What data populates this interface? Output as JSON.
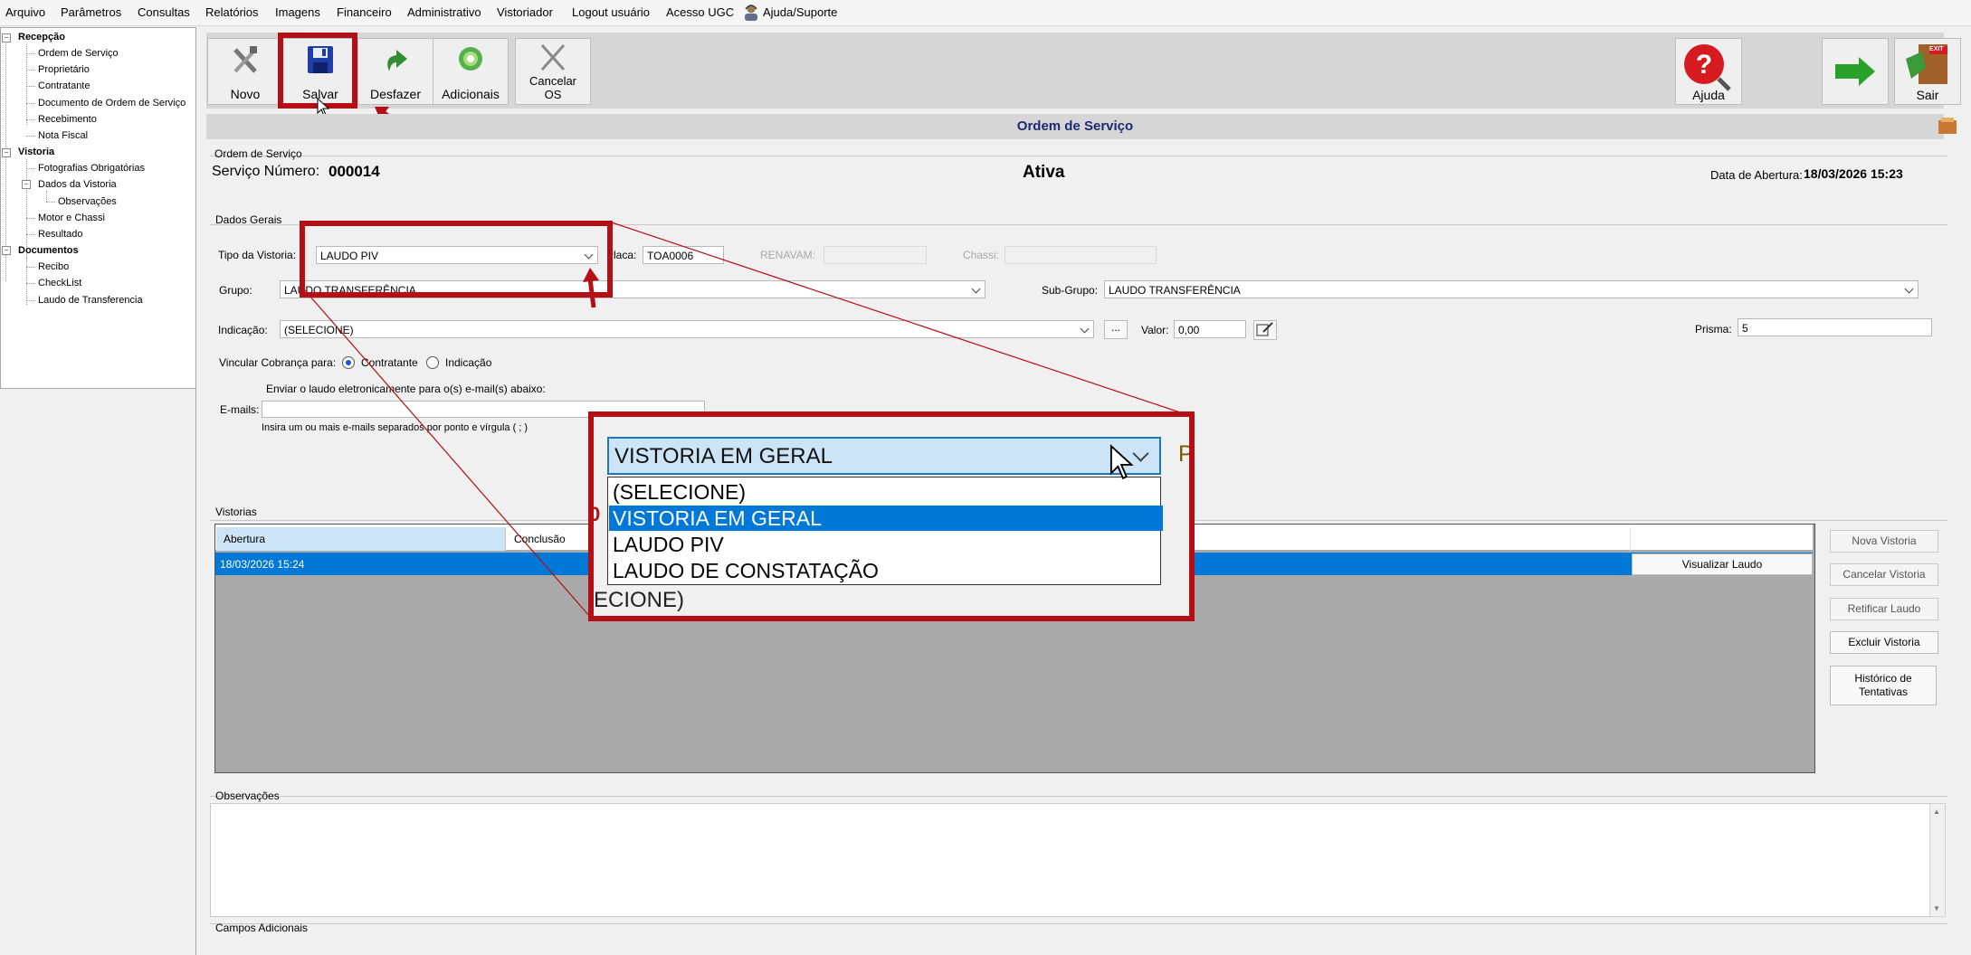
{
  "menu": [
    "Arquivo",
    "Parâmetros",
    "Consultas",
    "Relatórios",
    "Imagens",
    "Financeiro",
    "Administrativo",
    "Vistoriador",
    "Logout usuário",
    "Acesso UGC",
    "Ajuda/Suporte"
  ],
  "tree": {
    "recepcao": "Recepção",
    "recepcao_items": [
      "Ordem de Serviço",
      "Proprietário",
      "Contratante",
      "Documento de Ordem de Serviço",
      "Recebimento",
      "Nota Fiscal"
    ],
    "vistoria": "Vistoria",
    "vistoria_items": [
      "Fotografias Obrigatórias",
      "Dados da Vistoria",
      "Observações",
      "Motor e Chassi",
      "Resultado"
    ],
    "documentos": "Documentos",
    "documentos_items": [
      "Recibo",
      "CheckList",
      "Laudo de Transferencia"
    ]
  },
  "toolbar": {
    "novo": "Novo",
    "salvar": "Salvar",
    "desfazer": "Desfazer",
    "adicionais": "Adicionais",
    "cancelar_l1": "Cancelar",
    "cancelar_l2": "OS",
    "ajuda": "Ajuda",
    "sair": "Sair",
    "exit_sign": "EXIT"
  },
  "title": "Ordem de Serviço",
  "os": {
    "group_label": "Ordem de Serviço",
    "numero_label": "Serviço Número:",
    "numero": "000014",
    "status": "Ativa",
    "abertura_label": "Data de Abertura:",
    "abertura": "18/03/2026 15:23"
  },
  "dados": {
    "group_label": "Dados Gerais",
    "tipo_label": "Tipo da Vistoria:",
    "tipo_value": "LAUDO PIV",
    "placa_label": "Placa:",
    "placa_value": "TOA0006",
    "renavam_label": "RENAVAM:",
    "chassi_label": "Chassi:",
    "grupo_label": "Grupo:",
    "grupo_value": "LAUDO TRANSFERÊNCIA",
    "subgrupo_label": "Sub-Grupo:",
    "subgrupo_value": "LAUDO TRANSFERÊNCIA",
    "indicacao_label": "Indicação:",
    "indicacao_value": "(SELECIONE)",
    "ellipsis": "...",
    "valor_label": "Valor:",
    "valor_value": "0,00",
    "prisma_label": "Prisma:",
    "prisma_value": "5",
    "vincular_label": "Vincular Cobrança para:",
    "opt_contratante": "Contratante",
    "opt_indicacao": "Indicação",
    "enviar_label": "Enviar o laudo eletronicamente para o(s) e-mail(s) abaixo:",
    "emails_label": "E-mails:",
    "emails_hint": "Insira um ou mais e-mails separados por ponto e vírgula ( ; )"
  },
  "vistorias": {
    "group_label": "Vistorias",
    "headers": [
      "Abertura",
      "Conclusão"
    ],
    "row": {
      "abertura": "18/03/2026 15:24",
      "button": "Visualizar Laudo"
    },
    "side_buttons": [
      "Nova Vistoria",
      "Cancelar Vistoria",
      "Retificar Laudo",
      "Excluir Vistoria"
    ],
    "historico_l1": "Histórico de",
    "historico_l2": "Tentativas"
  },
  "observacoes_label": "Observações",
  "campos_label": "Campos Adicionais",
  "zoom": {
    "selected": "VISTORIA EM GERAL",
    "options": [
      "(SELECIONE)",
      "VISTORIA EM GERAL",
      "LAUDO PIV",
      "LAUDO DE CONSTATAÇÃO"
    ],
    "partial_bottom": "ECIONE)",
    "partial_right": "P",
    "partial_left": "0"
  },
  "colors": {
    "highlight": "#b40f14",
    "selection": "#0078d7",
    "title_text": "#1d2a72"
  }
}
